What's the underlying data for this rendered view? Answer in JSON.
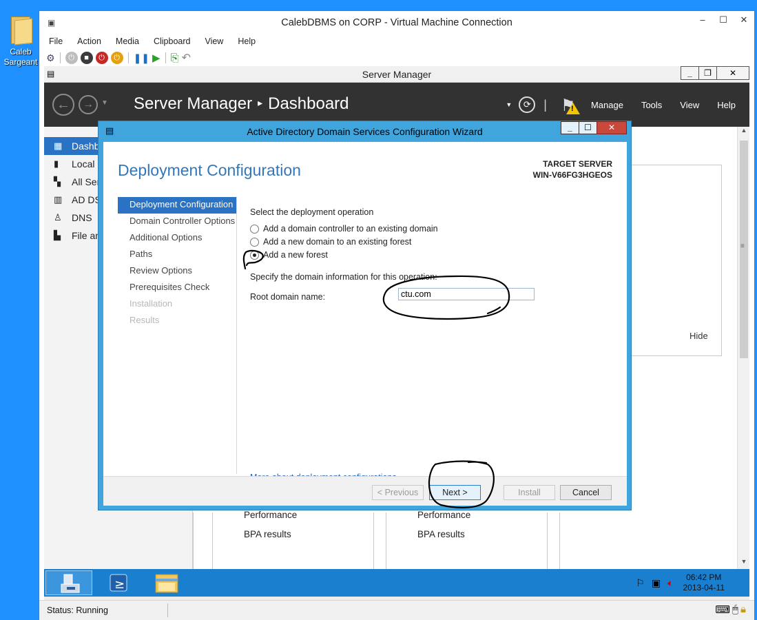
{
  "desktop": {
    "icon_label_line1": "Caleb",
    "icon_label_line2": "Sargeant"
  },
  "vm": {
    "title": "CalebDBMS on CORP - Virtual Machine Connection",
    "menu": [
      "File",
      "Action",
      "Media",
      "Clipboard",
      "View",
      "Help"
    ],
    "status": "Status: Running"
  },
  "server_manager": {
    "window_title": "Server Manager",
    "crumb_app": "Server Manager",
    "crumb_page": "Dashboard",
    "header_menu": [
      "Manage",
      "Tools",
      "View",
      "Help"
    ],
    "sidebar": [
      {
        "label": "Dashb",
        "active": true
      },
      {
        "label": "Local S"
      },
      {
        "label": "All Ser"
      },
      {
        "label": "AD DS"
      },
      {
        "label": "DNS"
      },
      {
        "label": "File an"
      }
    ],
    "hide_label": "Hide",
    "tiles": [
      {
        "line1": "Performance",
        "line2": "BPA results"
      },
      {
        "line1": "Performance",
        "line2": "BPA results"
      }
    ]
  },
  "taskbar": {
    "time": "06:42 PM",
    "date": "2013-04-11"
  },
  "wizard": {
    "title": "Active Directory Domain Services Configuration Wizard",
    "heading": "Deployment Configuration",
    "target_label": "TARGET SERVER",
    "target_name": "WIN-V66FG3HGEOS",
    "steps": [
      {
        "label": "Deployment Configuration",
        "state": "active"
      },
      {
        "label": "Domain Controller Options",
        "state": "normal"
      },
      {
        "label": "Additional Options",
        "state": "normal"
      },
      {
        "label": "Paths",
        "state": "normal"
      },
      {
        "label": "Review Options",
        "state": "normal"
      },
      {
        "label": "Prerequisites Check",
        "state": "normal"
      },
      {
        "label": "Installation",
        "state": "disabled"
      },
      {
        "label": "Results",
        "state": "disabled"
      }
    ],
    "operation_prompt": "Select the deployment operation",
    "options": [
      {
        "label": "Add a domain controller to an existing domain",
        "selected": false
      },
      {
        "label": "Add a new domain to an existing forest",
        "selected": false
      },
      {
        "label": "Add a new forest",
        "selected": true
      }
    ],
    "domain_info_prompt": "Specify the domain information for this operation:",
    "root_domain_label": "Root domain name:",
    "root_domain_value": "ctu.com",
    "more_link": "More about deployment configurations",
    "buttons": {
      "previous": "< Previous",
      "next": "Next >",
      "install": "Install",
      "cancel": "Cancel"
    }
  },
  "colors": {
    "desktop": "#1e90ff",
    "sm_header": "#323232",
    "accent": "#2a72c3",
    "wizard_frame": "#41a5dd",
    "taskbar": "#1b7fd0"
  }
}
